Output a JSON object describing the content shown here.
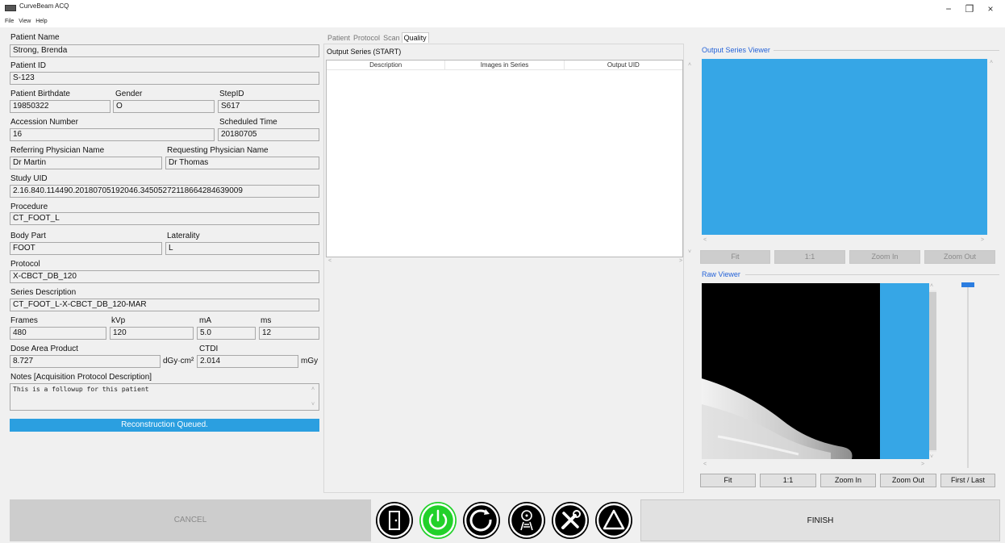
{
  "window": {
    "title": "CurveBeam ACQ",
    "menu": [
      "File",
      "View",
      "Help"
    ],
    "controls": {
      "minimize": "−",
      "restore": "❐",
      "close": "×"
    }
  },
  "patient": {
    "name_label": "Patient Name",
    "name": "Strong, Brenda",
    "id_label": "Patient ID",
    "id": "S-123",
    "birthdate_label": "Patient Birthdate",
    "birthdate": "19850322",
    "gender_label": "Gender",
    "gender": "O",
    "stepid_label": "StepID",
    "stepid": "S617",
    "accession_label": "Accession Number",
    "accession": "16",
    "scheduled_label": "Scheduled Time",
    "scheduled": "20180705",
    "referring_label": "Referring Physician Name",
    "referring": "Dr Martin",
    "requesting_label": "Requesting Physician Name",
    "requesting": "Dr Thomas",
    "study_uid_label": "Study UID",
    "study_uid": "2.16.840.114490.20180705192046.34505272118664284639009",
    "procedure_label": "Procedure",
    "procedure": "CT_FOOT_L",
    "body_part_label": "Body Part",
    "body_part": "FOOT",
    "laterality_label": "Laterality",
    "laterality": "L",
    "protocol_label": "Protocol",
    "protocol": "X-CBCT_DB_120",
    "series_desc_label": "Series Description",
    "series_desc": "CT_FOOT_L-X-CBCT_DB_120-MAR",
    "frames_label": "Frames",
    "frames": "480",
    "kvp_label": "kVp",
    "kvp": "120",
    "ma_label": "mA",
    "ma": "5.0",
    "ms_label": "ms",
    "ms": "12",
    "dap_label": "Dose Area Product",
    "dap": "8.727",
    "dap_unit": "dGy·cm²",
    "ctdi_label": "CTDI",
    "ctdi": "2.014",
    "ctdi_unit": "mGy",
    "notes_label": "Notes [Acquisition Protocol Description]",
    "notes": "This is a followup for this patient"
  },
  "status": "Reconstruction Queued.",
  "tabs": [
    {
      "label": "Patient",
      "active": false
    },
    {
      "label": "Protocol",
      "active": false
    },
    {
      "label": "Scan",
      "active": false
    },
    {
      "label": "Quality",
      "active": true
    }
  ],
  "output_series": {
    "title": "Output Series (START)",
    "columns": [
      "Description",
      "Images in Series",
      "Output UID"
    ]
  },
  "output_viewer": {
    "title": "Output Series Viewer",
    "buttons": [
      "Fit",
      "1:1",
      "Zoom In",
      "Zoom Out"
    ]
  },
  "raw_viewer": {
    "title": "Raw Viewer",
    "buttons": [
      "Fit",
      "1:1",
      "Zoom In",
      "Zoom Out",
      "First / Last"
    ]
  },
  "footer": {
    "cancel": "CANCEL",
    "finish": "FINISH",
    "icons": [
      "door-exit-icon",
      "power-icon",
      "refresh-icon",
      "radiation-icon",
      "tools-icon",
      "warning-triangle-icon"
    ]
  },
  "colors": {
    "accent_blue": "#36a6e6",
    "status_blue": "#2b9fe0",
    "power_green": "#22d12a",
    "link_blue": "#2563d8"
  }
}
